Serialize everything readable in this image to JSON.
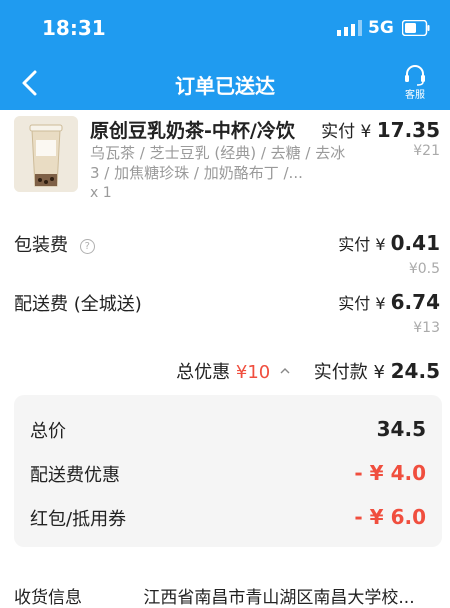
{
  "status_bar": {
    "time": "18:31",
    "network": "5G",
    "signal_icon": "signal-icon",
    "battery_icon": "battery-icon"
  },
  "nav": {
    "title": "订单已送达",
    "back_icon": "back-arrow-icon",
    "service_label": "客服",
    "service_icon": "headset-icon"
  },
  "product": {
    "name": "原创豆乳奶茶-中杯/冷饮",
    "paid_label": "实付 ¥",
    "paid_amount": "17.35",
    "original_price": "¥21",
    "spec": "乌瓦茶 / 芝士豆乳 (经典) / 去糖 / 去冰3 / 加焦糖珍珠 / 加奶酪布丁 /...",
    "quantity": "x 1"
  },
  "fees": {
    "packaging": {
      "label": "包装费",
      "paid_label": "实付 ¥",
      "paid_amount": "0.41",
      "original": "¥0.5",
      "help_icon": "help-circle-icon"
    },
    "delivery": {
      "label": "配送费 (全城送)",
      "paid_label": "实付 ¥",
      "paid_amount": "6.74",
      "original": "¥13"
    }
  },
  "summary": {
    "discount_label": "总优惠",
    "discount_value": "¥10",
    "paid_label": "实付款 ¥",
    "paid_amount": "24.5"
  },
  "breakdown": {
    "total_label": "总价",
    "total_value": "34.5",
    "delivery_discount_label": "配送费优惠",
    "delivery_discount_value": "- ¥ 4.0",
    "coupon_label": "红包/抵用券",
    "coupon_value": "- ¥ 6.0"
  },
  "bottom": {
    "label": "收货信息",
    "address": "江西省南昌市青山湖区南昌大学校..."
  },
  "colors": {
    "primary": "#1f9bf0",
    "discount_red": "#f04e3e",
    "muted": "#9a9a9a",
    "card_bg": "#f5f5f5"
  }
}
